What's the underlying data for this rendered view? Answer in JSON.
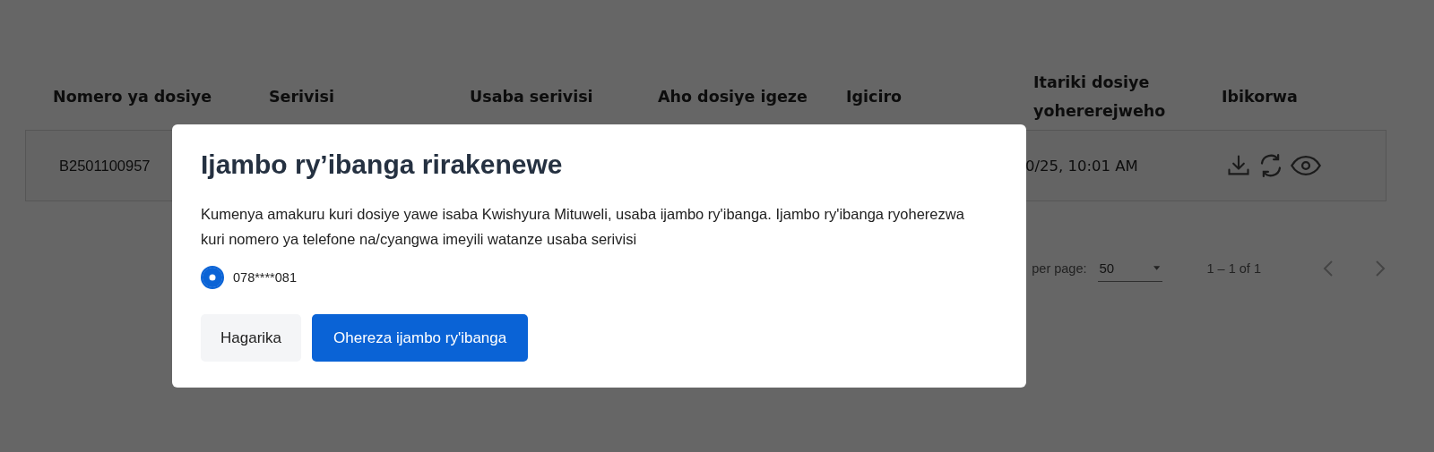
{
  "table": {
    "columns": [
      "Nomero ya dosiye",
      "Serivisi",
      "Usaba serivisi",
      "Aho dosiye igeze",
      "Igiciro",
      "Itariki dosiye yohererejweho",
      "Ibikorwa"
    ],
    "rows": [
      {
        "file_number": "B2501100957",
        "submitted_date": "0/25, 10:01 AM"
      }
    ]
  },
  "paginator": {
    "items_per_page_label": "per page:",
    "page_size": "50",
    "range": "1 – 1 of 1",
    "prev_disabled": true,
    "next_disabled": true
  },
  "dialog": {
    "title": "Ijambo ry’ibanga rirakenewe",
    "message": "Kumenya amakuru kuri dosiye yawe isaba Kwishyura Mituweli, usaba ijambo ry'ibanga. Ijambo ry'ibanga ryoherezwa kuri nomero ya telefone na/cyangwa imeyili watanze usaba serivisi",
    "options": [
      {
        "label": "078****081",
        "selected": true
      }
    ],
    "buttons": [
      {
        "label": "Hagarika",
        "kind": "secondary"
      },
      {
        "label": "Ohereza ijambo ry'ibanga",
        "kind": "primary"
      }
    ]
  }
}
